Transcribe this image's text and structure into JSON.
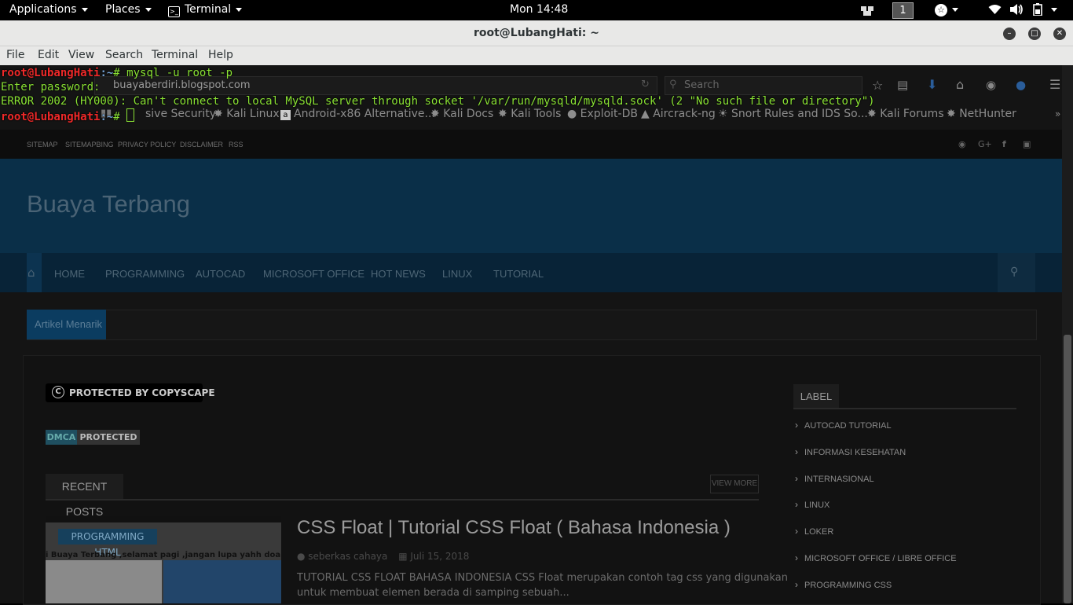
{
  "topbar": {
    "applications": "Applications",
    "places": "Places",
    "terminal": "Terminal",
    "clock": "Mon 14:48",
    "workspace": "1",
    "icons": [
      "workspace-switcher-icon",
      "accessibility-icon",
      "wifi-icon",
      "volume-icon",
      "battery-icon",
      "power-menu-icon"
    ]
  },
  "window": {
    "title": "root@LubangHati: ~",
    "menus": [
      "File",
      "Edit",
      "View",
      "Search",
      "Terminal",
      "Help"
    ]
  },
  "terminal": {
    "prompt_user": "root@LubangHati",
    "prompt_path": ":~",
    "prompt_symbol": "# ",
    "command": "mysql -u root -p",
    "password_prompt": "Enter password: ",
    "error": "ERROR 2002 (HY000): Can't connect to local MySQL server through socket '/var/run/mysqld/mysqld.sock' (2 \"No such file or directory\")"
  },
  "browser_bg": {
    "url": "buayaberdiri.blogspot.com",
    "search_placeholder": "Search",
    "bookmarks": [
      "sive Security",
      "Kali Linux",
      "Android-x86 Alternative...",
      "Kali Docs",
      "Kali Tools",
      "Exploit-DB",
      "Aircrack-ng",
      "Snort Rules and IDS So...",
      "Kali Forums",
      "NetHunter"
    ],
    "bookmark_overflow": "»",
    "site_top_links": [
      "SITEMAP",
      "SITEMAPBING",
      "PRIVACY POLICY",
      "DISCLAIMER",
      "RSS"
    ],
    "site_title": "Buaya Terbang",
    "nav": [
      "HOME",
      "PROGRAMMING",
      "AUTOCAD",
      "MICROSOFT OFFICE",
      "HOT NEWS",
      "LINUX",
      "TUTORIAL"
    ],
    "artikel_menarik": "Artikel Menarik",
    "copyscape": "PROTECTED BY COPYSCAPE",
    "dmca_a": "DMCA",
    "dmca_b": "PROTECTED",
    "recent_posts": "RECENT POSTS",
    "view_more": "VIEW MORE",
    "post": {
      "tag": "PROGRAMMING HTML",
      "thumb_text": "i Buaya Terbang ,selamat pagi ,jangan lupa yahh doa pagi yahh :)",
      "title": "CSS Float | Tutorial CSS Float ( Bahasa Indonesia )",
      "author": "seberkas cahaya",
      "date": "Juli 15, 2018",
      "excerpt_line1": "TUTORIAL CSS FLOAT BAHASA INDONESIA CSS Float merupakan contoh tag css yang digunakan",
      "excerpt_line2": "untuk membuat elemen berada di samping  sebuah..."
    },
    "label_heading": "LABEL",
    "labels": [
      "AUTOCAD TUTORIAL",
      "INFORMASI KESEHATAN",
      "INTERNASIONAL",
      "LINUX",
      "LOKER",
      "MICROSOFT OFFICE / LIBRE OFFICE",
      "PROGRAMMING CSS"
    ]
  }
}
